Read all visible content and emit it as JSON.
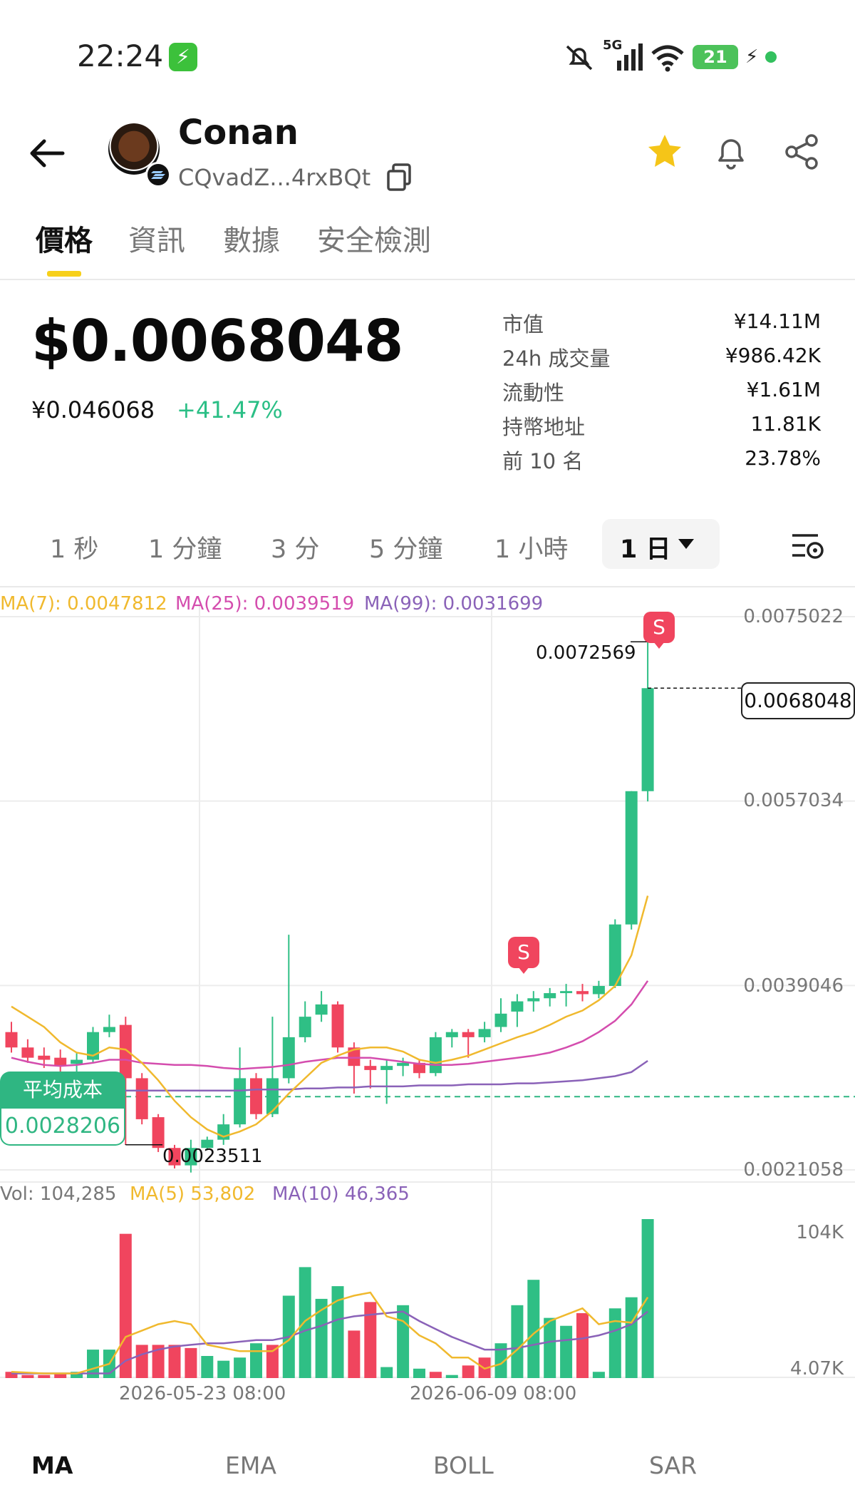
{
  "status_bar": {
    "time": "22:24",
    "network": "5G",
    "battery": "21"
  },
  "header": {
    "name": "Conan",
    "address": "CQvadZ...4rxBQt"
  },
  "tabs": [
    {
      "label": "價格",
      "active": true
    },
    {
      "label": "資訊"
    },
    {
      "label": "數據"
    },
    {
      "label": "安全檢測"
    }
  ],
  "price": {
    "usd": "$0.0068048",
    "cny": "¥0.046068",
    "change": "+41.47%"
  },
  "stats": [
    {
      "label": "市值",
      "value": "¥14.11M"
    },
    {
      "label": "24h 成交量",
      "value": "¥986.42K"
    },
    {
      "label": "流動性",
      "value": "¥1.61M"
    },
    {
      "label": "持幣地址",
      "value": "11.81K"
    },
    {
      "label": "前 10 名",
      "value": "23.78%"
    }
  ],
  "intervals": [
    "1 秒",
    "1 分鐘",
    "3 分",
    "5 分鐘",
    "1 小時"
  ],
  "interval_active": "1 日",
  "ma_legend": {
    "ma7": "MA(7): 0.0047812",
    "ma25": "MA(25): 0.0039519",
    "ma99": "MA(99): 0.0031699"
  },
  "price_axis": [
    "0.0075022",
    "0.0057034",
    "0.0039046",
    "0.0021058"
  ],
  "annotations": {
    "high": "0.0072569",
    "low": "0.0023511",
    "current": "0.0068048",
    "sell_marker": "S"
  },
  "avg_cost": {
    "label": "平均成本",
    "value": "0.0028206"
  },
  "vol_legend": {
    "vol": "Vol: 104,285",
    "ma5": "MA(5) 53,802",
    "ma10": "MA(10) 46,365"
  },
  "vol_axis": [
    "104K",
    "4.07K"
  ],
  "dates": [
    "2026-05-23 08:00",
    "2026-06-09 08:00"
  ],
  "indicator_tabs": [
    "MA",
    "EMA",
    "BOLL",
    "SAR"
  ],
  "colors": {
    "up": "#2fbf85",
    "down": "#f0455e",
    "ma7": "#f0b92e",
    "ma25": "#d44dae",
    "ma99": "#8a62b8",
    "accent": "#f7d01a"
  },
  "chart_data": {
    "type": "candlestick",
    "ylim": [
      0.0021058,
      0.0075022
    ],
    "yticks": [
      0.0075022,
      0.0057034,
      0.0039046,
      0.0021058
    ],
    "candles": [
      {
        "o": 0.00345,
        "c": 0.0033,
        "h": 0.00355,
        "l": 0.00325
      },
      {
        "o": 0.0033,
        "c": 0.0032,
        "h": 0.00338,
        "l": 0.00315
      },
      {
        "o": 0.00322,
        "c": 0.00318,
        "h": 0.0033,
        "l": 0.0031
      },
      {
        "o": 0.0032,
        "c": 0.00312,
        "h": 0.00328,
        "l": 0.003
      },
      {
        "o": 0.00314,
        "c": 0.00318,
        "h": 0.00325,
        "l": 0.00305
      },
      {
        "o": 0.00318,
        "c": 0.00345,
        "h": 0.0035,
        "l": 0.00315
      },
      {
        "o": 0.00345,
        "c": 0.0035,
        "h": 0.00362,
        "l": 0.0034
      },
      {
        "o": 0.00352,
        "c": 0.003,
        "h": 0.0036,
        "l": 0.00235
      },
      {
        "o": 0.003,
        "c": 0.0026,
        "h": 0.00305,
        "l": 0.00255
      },
      {
        "o": 0.00262,
        "c": 0.00232,
        "h": 0.00265,
        "l": 0.00228
      },
      {
        "o": 0.00232,
        "c": 0.00215,
        "h": 0.00235,
        "l": 0.00212
      },
      {
        "o": 0.00215,
        "c": 0.00232,
        "h": 0.0024,
        "l": 0.00208
      },
      {
        "o": 0.00232,
        "c": 0.0024,
        "h": 0.00243,
        "l": 0.0023
      },
      {
        "o": 0.0024,
        "c": 0.00255,
        "h": 0.00265,
        "l": 0.00235
      },
      {
        "o": 0.00255,
        "c": 0.003,
        "h": 0.0033,
        "l": 0.00252
      },
      {
        "o": 0.003,
        "c": 0.00265,
        "h": 0.00305,
        "l": 0.0026
      },
      {
        "o": 0.00265,
        "c": 0.003,
        "h": 0.0036,
        "l": 0.00262
      },
      {
        "o": 0.003,
        "c": 0.0034,
        "h": 0.0044,
        "l": 0.00295
      },
      {
        "o": 0.0034,
        "c": 0.0036,
        "h": 0.00375,
        "l": 0.00335
      },
      {
        "o": 0.00362,
        "c": 0.00372,
        "h": 0.00385,
        "l": 0.00355
      },
      {
        "o": 0.00372,
        "c": 0.0033,
        "h": 0.00375,
        "l": 0.00325
      },
      {
        "o": 0.0033,
        "c": 0.00312,
        "h": 0.00335,
        "l": 0.00285
      },
      {
        "o": 0.00312,
        "c": 0.00308,
        "h": 0.00318,
        "l": 0.0029
      },
      {
        "o": 0.00308,
        "c": 0.00312,
        "h": 0.00318,
        "l": 0.00275
      },
      {
        "o": 0.00312,
        "c": 0.00315,
        "h": 0.0032,
        "l": 0.00302
      },
      {
        "o": 0.00315,
        "c": 0.00305,
        "h": 0.00318,
        "l": 0.003
      },
      {
        "o": 0.00305,
        "c": 0.0034,
        "h": 0.00345,
        "l": 0.00302
      },
      {
        "o": 0.0034,
        "c": 0.00345,
        "h": 0.00348,
        "l": 0.0033
      },
      {
        "o": 0.00345,
        "c": 0.0034,
        "h": 0.00348,
        "l": 0.0032
      },
      {
        "o": 0.0034,
        "c": 0.00348,
        "h": 0.00355,
        "l": 0.00335
      },
      {
        "o": 0.0035,
        "c": 0.00363,
        "h": 0.00378,
        "l": 0.00345
      },
      {
        "o": 0.00365,
        "c": 0.00375,
        "h": 0.00382,
        "l": 0.0035
      },
      {
        "o": 0.00375,
        "c": 0.00378,
        "h": 0.00385,
        "l": 0.00365
      },
      {
        "o": 0.00378,
        "c": 0.00383,
        "h": 0.00388,
        "l": 0.0037
      },
      {
        "o": 0.00383,
        "c": 0.00385,
        "h": 0.00392,
        "l": 0.0037
      },
      {
        "o": 0.00385,
        "c": 0.00382,
        "h": 0.00392,
        "l": 0.00375
      },
      {
        "o": 0.00382,
        "c": 0.0039,
        "h": 0.00395,
        "l": 0.00378
      },
      {
        "o": 0.0039,
        "c": 0.0045,
        "h": 0.00455,
        "l": 0.00388
      },
      {
        "o": 0.0045,
        "c": 0.0058,
        "h": 0.0058,
        "l": 0.00445
      },
      {
        "o": 0.0058,
        "c": 0.0068048,
        "h": 0.0072569,
        "l": 0.0057
      }
    ],
    "ma7": [
      0.0037,
      0.0036,
      0.0035,
      0.00335,
      0.00325,
      0.00322,
      0.0033,
      0.00328,
      0.00315,
      0.00298,
      0.00278,
      0.00262,
      0.0025,
      0.00243,
      0.00248,
      0.00255,
      0.00268,
      0.00285,
      0.003,
      0.00315,
      0.00322,
      0.00328,
      0.0033,
      0.0033,
      0.00326,
      0.00318,
      0.00315,
      0.00318,
      0.00322,
      0.00328,
      0.00334,
      0.0034,
      0.00345,
      0.00352,
      0.0036,
      0.00366,
      0.00376,
      0.0039,
      0.0042,
      0.00478
    ],
    "ma25": [
      0.0032,
      0.00316,
      0.00313,
      0.00312,
      0.00313,
      0.00315,
      0.00318,
      0.00318,
      0.00315,
      0.00314,
      0.00313,
      0.00313,
      0.00312,
      0.0031,
      0.00309,
      0.0031,
      0.00311,
      0.00313,
      0.00316,
      0.00318,
      0.0032,
      0.0032,
      0.0032,
      0.00318,
      0.00316,
      0.00314,
      0.00313,
      0.00313,
      0.00314,
      0.00316,
      0.00318,
      0.0032,
      0.00322,
      0.00325,
      0.0033,
      0.00336,
      0.00345,
      0.00356,
      0.00372,
      0.00395
    ],
    "ma99": [
      0.00295,
      0.00292,
      0.0029,
      0.00289,
      0.00288,
      0.00288,
      0.00288,
      0.00288,
      0.00288,
      0.00288,
      0.00288,
      0.00288,
      0.00288,
      0.00288,
      0.00288,
      0.00289,
      0.00289,
      0.00289,
      0.0029,
      0.0029,
      0.00291,
      0.00291,
      0.00292,
      0.00292,
      0.00292,
      0.00293,
      0.00293,
      0.00293,
      0.00294,
      0.00294,
      0.00294,
      0.00295,
      0.00295,
      0.00296,
      0.00297,
      0.00298,
      0.003,
      0.00302,
      0.00306,
      0.00317
    ],
    "volume": {
      "ylim": [
        4070,
        104285
      ],
      "values": [
        8000,
        6000,
        6000,
        7000,
        8000,
        22000,
        22000,
        95000,
        25000,
        25000,
        25000,
        23000,
        18000,
        15000,
        17000,
        26000,
        25000,
        56000,
        74000,
        54000,
        62000,
        34000,
        52000,
        11000,
        50000,
        10000,
        8000,
        6000,
        12000,
        17000,
        26000,
        50000,
        66000,
        42000,
        37000,
        45000,
        8000,
        48000,
        55000,
        104285
      ],
      "up": [
        false,
        false,
        false,
        false,
        true,
        true,
        true,
        false,
        false,
        false,
        false,
        false,
        true,
        true,
        true,
        true,
        false,
        true,
        true,
        true,
        true,
        false,
        false,
        true,
        true,
        true,
        false,
        true,
        false,
        false,
        true,
        true,
        true,
        true,
        true,
        false,
        true,
        true,
        true,
        true
      ],
      "ma5": [
        8000,
        7500,
        7000,
        7000,
        7000,
        10000,
        13000,
        30000,
        34000,
        38000,
        40000,
        38000,
        25000,
        23000,
        21000,
        21000,
        21000,
        28000,
        40000,
        47000,
        53000,
        56000,
        58000,
        43000,
        40000,
        31000,
        26000,
        17000,
        17000,
        10000,
        13000,
        22000,
        32000,
        40000,
        44000,
        48000,
        38000,
        40000,
        39000,
        55000
      ],
      "ma10": [
        7000,
        7000,
        7000,
        7000,
        7000,
        7000,
        7000,
        15000,
        19000,
        22000,
        24000,
        25000,
        26000,
        26000,
        27000,
        28000,
        28000,
        30000,
        34000,
        37000,
        41000,
        43000,
        44000,
        45000,
        46000,
        40000,
        35000,
        30000,
        26000,
        22000,
        22000,
        23000,
        25000,
        27000,
        28000,
        29000,
        31000,
        34000,
        38000,
        46000
      ]
    }
  }
}
